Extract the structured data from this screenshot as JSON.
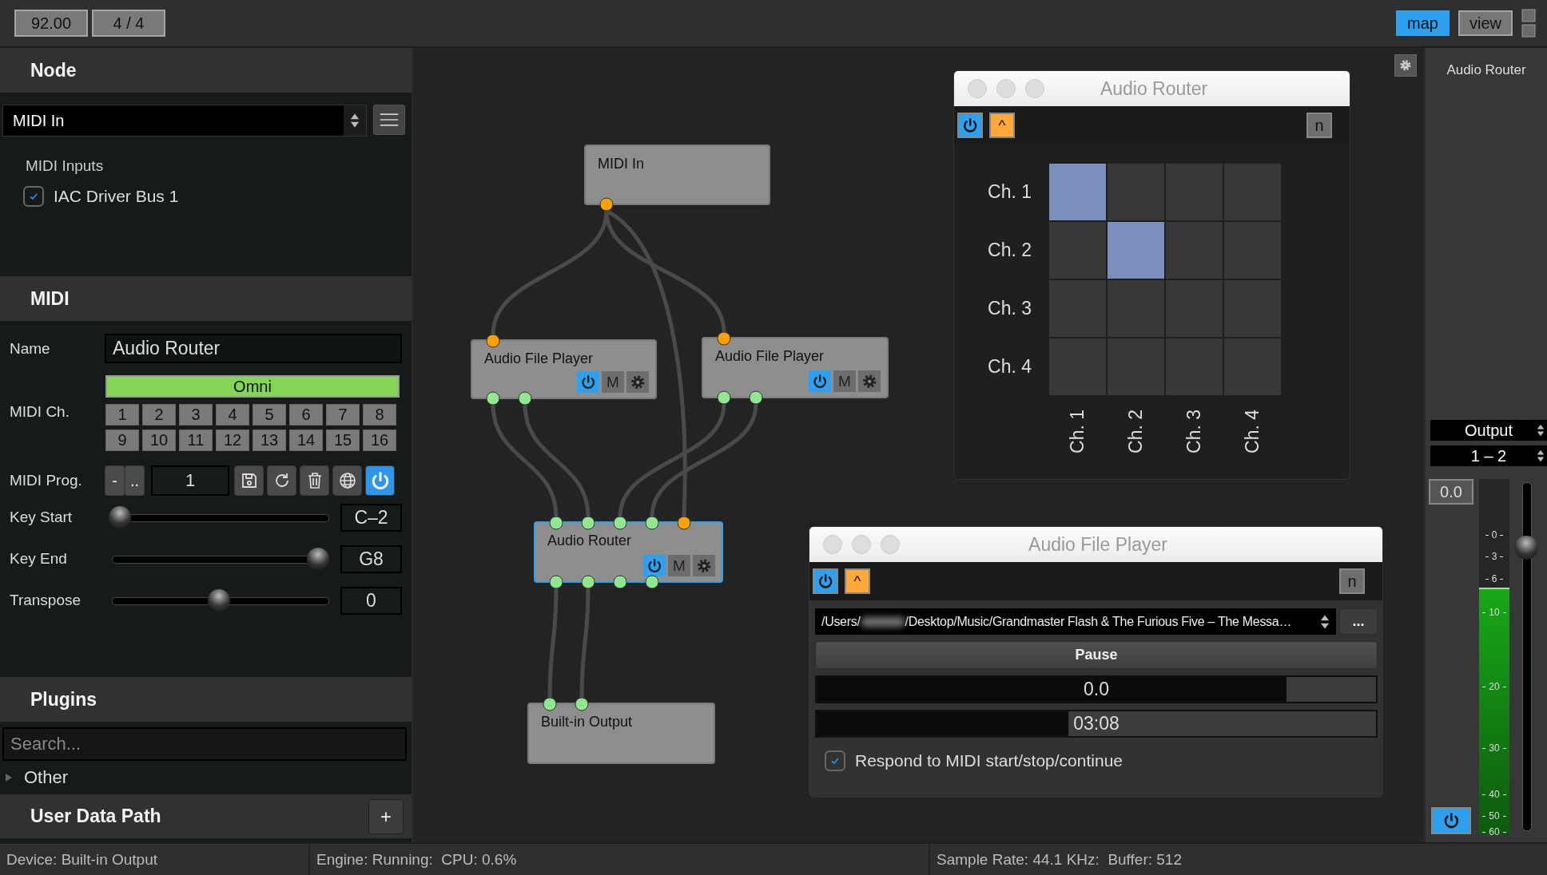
{
  "transport": {
    "tempo": "92.00",
    "time_signature": "4 / 4"
  },
  "view_buttons": [
    {
      "label": "map",
      "selected": true
    },
    {
      "label": "view",
      "selected": false
    }
  ],
  "node_panel": {
    "title": "Node",
    "node_select": "MIDI In",
    "inputs_label": "MIDI Inputs",
    "inputs": [
      {
        "label": "IAC Driver Bus 1",
        "checked": true
      }
    ]
  },
  "midi_panel": {
    "title": "MIDI",
    "name_label": "Name",
    "name_value": "Audio Router",
    "channel_label": "MIDI Ch.",
    "omni": {
      "label": "Omni",
      "selected": true
    },
    "channels": [
      {
        "label": "1",
        "selected": false
      },
      {
        "label": "2",
        "selected": false
      },
      {
        "label": "3",
        "selected": false
      },
      {
        "label": "4",
        "selected": false
      },
      {
        "label": "5",
        "selected": false
      },
      {
        "label": "6",
        "selected": false
      },
      {
        "label": "7",
        "selected": false
      },
      {
        "label": "8",
        "selected": false
      },
      {
        "label": "9",
        "selected": false
      },
      {
        "label": "10",
        "selected": false
      },
      {
        "label": "11",
        "selected": false
      },
      {
        "label": "12",
        "selected": false
      },
      {
        "label": "13",
        "selected": false
      },
      {
        "label": "14",
        "selected": false
      },
      {
        "label": "15",
        "selected": false
      },
      {
        "label": "16",
        "selected": false
      }
    ],
    "program_label": "MIDI Prog.",
    "program_buttons": [
      "-",
      ".."
    ],
    "program_value": "1",
    "power_on": true,
    "sliders": [
      {
        "label": "Key Start",
        "level": 0,
        "value": "C–2"
      },
      {
        "label": "Key End",
        "level": 1,
        "value": "G8"
      },
      {
        "label": "Transpose",
        "level": 0.5,
        "value": "0"
      }
    ]
  },
  "plugins_panel": {
    "title": "Plugins",
    "search_placeholder": "Search...",
    "categories": [
      {
        "label": "Other",
        "expanded": false
      }
    ]
  },
  "user_data_panel": {
    "title": "User Data Path",
    "add_button": "+"
  },
  "graph": {
    "nodes": [
      {
        "label": "MIDI In",
        "has_controls": false,
        "selected": false,
        "outputs": [
          {
            "kind": "midi"
          }
        ]
      },
      {
        "label": "Audio File Player",
        "has_controls": true,
        "power_on": true,
        "mute_label": "M",
        "selected": false,
        "inputs": [
          {
            "kind": "midi"
          }
        ],
        "outputs": [
          {
            "kind": "audio"
          },
          {
            "kind": "audio"
          }
        ]
      },
      {
        "label": "Audio File Player",
        "has_controls": true,
        "power_on": true,
        "mute_label": "M",
        "selected": false,
        "inputs": [
          {
            "kind": "midi"
          }
        ],
        "outputs": [
          {
            "kind": "audio"
          },
          {
            "kind": "audio"
          }
        ]
      },
      {
        "label": "Audio Router",
        "has_controls": true,
        "power_on": true,
        "mute_label": "M",
        "selected": true,
        "inputs": [
          {
            "kind": "audio"
          },
          {
            "kind": "audio"
          },
          {
            "kind": "audio"
          },
          {
            "kind": "audio"
          },
          {
            "kind": "midi"
          }
        ],
        "outputs": [
          {
            "kind": "audio"
          },
          {
            "kind": "audio"
          },
          {
            "kind": "audio"
          },
          {
            "kind": "audio"
          }
        ]
      },
      {
        "label": "Built-in Output",
        "has_controls": false,
        "selected": false,
        "inputs": [
          {
            "kind": "audio"
          },
          {
            "kind": "audio"
          }
        ]
      }
    ]
  },
  "router_window": {
    "title": "Audio Router",
    "power_on": true,
    "up_button": "^",
    "n_button": "n",
    "rows": [
      {
        "label": "Ch. 1",
        "cells": [
          {
            "selected": true
          },
          {
            "selected": false
          },
          {
            "selected": false
          },
          {
            "selected": false
          }
        ]
      },
      {
        "label": "Ch. 2",
        "cells": [
          {
            "selected": false
          },
          {
            "selected": true
          },
          {
            "selected": false
          },
          {
            "selected": false
          }
        ]
      },
      {
        "label": "Ch. 3",
        "cells": [
          {
            "selected": false
          },
          {
            "selected": false
          },
          {
            "selected": false
          },
          {
            "selected": false
          }
        ]
      },
      {
        "label": "Ch. 4",
        "cells": [
          {
            "selected": false
          },
          {
            "selected": false
          },
          {
            "selected": false
          },
          {
            "selected": false
          }
        ]
      }
    ],
    "columns": [
      "Ch. 1",
      "Ch. 2",
      "Ch. 3",
      "Ch. 4"
    ]
  },
  "player_window": {
    "title": "Audio File Player",
    "power_on": true,
    "up_button": "^",
    "n_button": "n",
    "path_start": "/Users/",
    "path_rest": "/Desktop/Music/Grandmaster Flash & The Furious Five – The Messa…",
    "browse_button": "...",
    "play_button": "Pause",
    "gain": {
      "value": "0.0",
      "level": 0.84
    },
    "position": {
      "value": "03:08",
      "level": 0.45
    },
    "midi_sync": {
      "label": "Respond to MIDI start/stop/continue",
      "checked": true
    }
  },
  "inspector": {
    "title": "Audio Router",
    "output_select": "Output",
    "channel_select": "1 – 2",
    "gain_value": "0.0",
    "meter": {
      "level": 0.69
    },
    "scale": [
      "0",
      "3",
      "6",
      "10",
      "20",
      "30",
      "40",
      "50",
      "60"
    ],
    "fader": {
      "level": 0.83
    },
    "power_on": true
  },
  "status_bar": [
    "Device: Built-in Output",
    "Engine: Running:  CPU: 0.6%",
    "Sample Rate: 44.1 KHz:  Buffer: 512"
  ]
}
